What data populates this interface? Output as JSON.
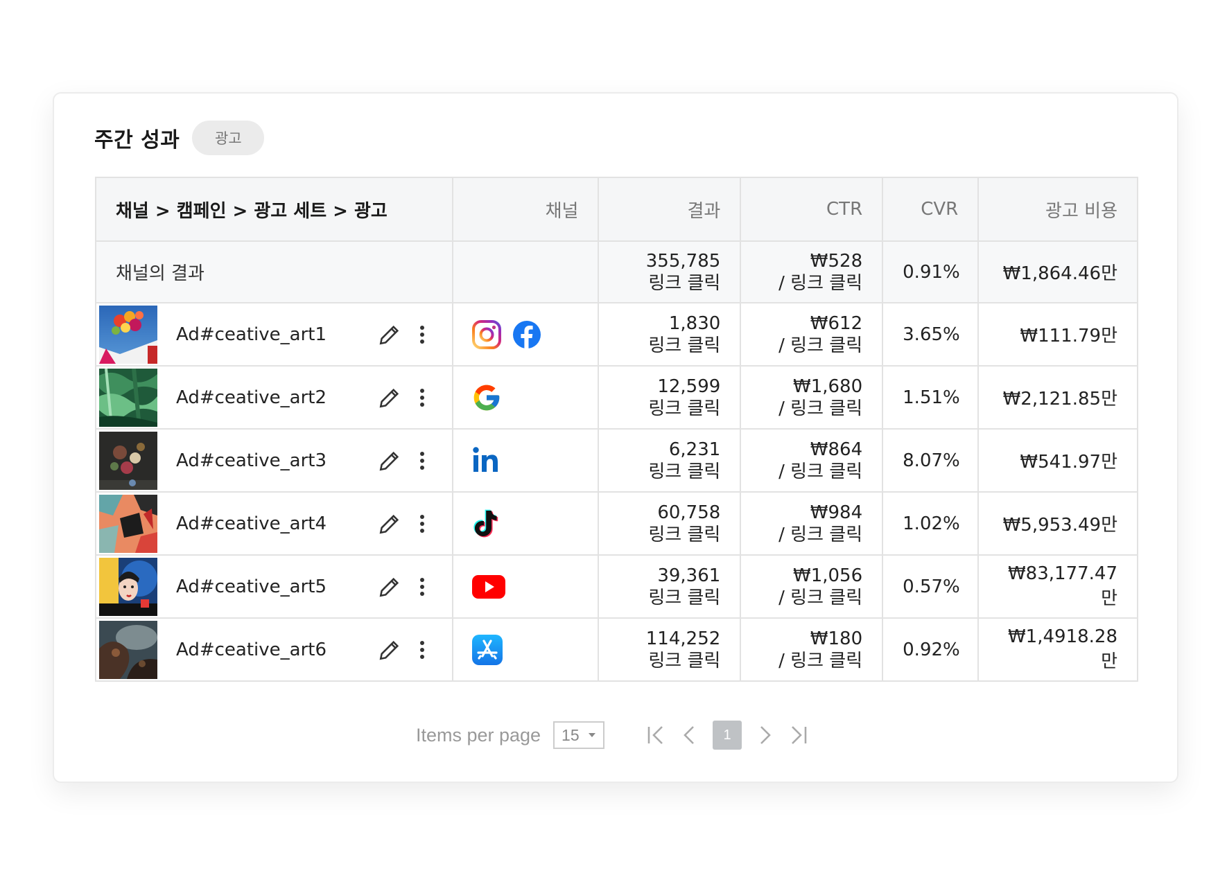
{
  "header": {
    "title": "주간 성과",
    "tag": "광고"
  },
  "table": {
    "columns": [
      "채널 > 캠페인 > 광고 세트 > 광고",
      "채널",
      "결과",
      "CTR",
      "CVR",
      "광고 비용"
    ],
    "summary": {
      "label": "채널의 결과",
      "result_value": "355,785",
      "result_unit": "링크 클릭",
      "ctr_value": "₩528",
      "ctr_unit": "/ 링크 클릭",
      "cvr": "0.91%",
      "cost": "₩1,864.46만"
    },
    "rows": [
      {
        "name": "Ad#ceative_art1",
        "channels": [
          "instagram-icon",
          "facebook-icon"
        ],
        "result_value": "1,830",
        "result_unit": "링크 클릭",
        "ctr_value": "₩612",
        "ctr_unit": "/ 링크 클릭",
        "cvr": "3.65%",
        "cost": "₩111.79만"
      },
      {
        "name": "Ad#ceative_art2",
        "channels": [
          "google-icon"
        ],
        "result_value": "12,599",
        "result_unit": "링크 클릭",
        "ctr_value": "₩1,680",
        "ctr_unit": "/ 링크 클릭",
        "cvr": "1.51%",
        "cost": "₩2,121.85만"
      },
      {
        "name": "Ad#ceative_art3",
        "channels": [
          "linkedin-icon"
        ],
        "result_value": "6,231",
        "result_unit": "링크 클릭",
        "ctr_value": "₩864",
        "ctr_unit": "/ 링크 클릭",
        "cvr": "8.07%",
        "cost": "₩541.97만"
      },
      {
        "name": "Ad#ceative_art4",
        "channels": [
          "tiktok-icon"
        ],
        "result_value": "60,758",
        "result_unit": "링크 클릭",
        "ctr_value": "₩984",
        "ctr_unit": "/ 링크 클릭",
        "cvr": "1.02%",
        "cost": "₩5,953.49만"
      },
      {
        "name": "Ad#ceative_art5",
        "channels": [
          "youtube-icon"
        ],
        "result_value": "39,361",
        "result_unit": "링크 클릭",
        "ctr_value": "₩1,056",
        "ctr_unit": "/ 링크 클릭",
        "cvr": "0.57%",
        "cost": "₩83,177.47만"
      },
      {
        "name": "Ad#ceative_art6",
        "channels": [
          "app-store-icon"
        ],
        "result_value": "114,252",
        "result_unit": "링크 클릭",
        "ctr_value": "₩180",
        "ctr_unit": "/ 링크 클릭",
        "cvr": "0.92%",
        "cost": "₩1,4918.28만"
      }
    ]
  },
  "pagination": {
    "items_per_page_label": "Items per page",
    "items_per_page_value": "15",
    "current_page": "1"
  },
  "colors": {
    "header_bg": "#f5f6f7",
    "border": "#e2e2e2",
    "tag_bg": "#ebebeb",
    "page_active": "#bfc2c5"
  }
}
